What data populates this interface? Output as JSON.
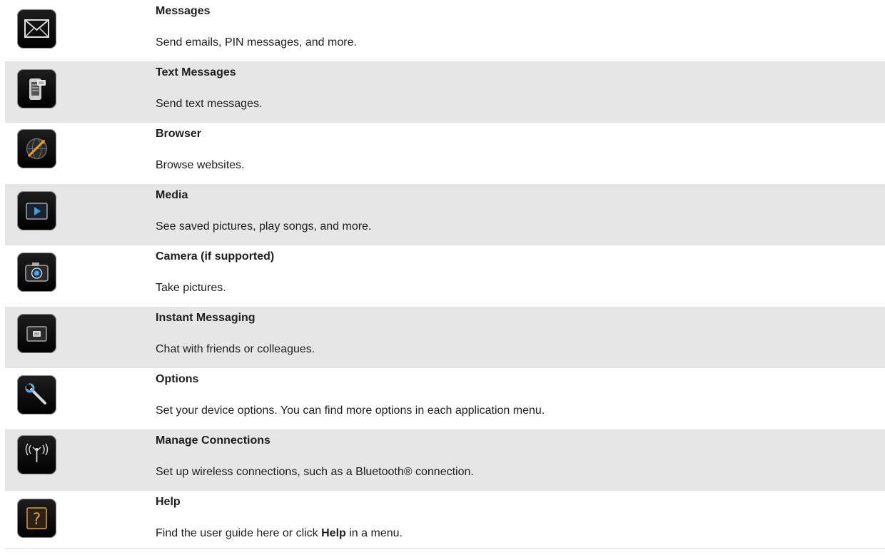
{
  "rows": [
    {
      "icon": "envelope-icon",
      "title": "Messages",
      "desc": "Send emails, PIN messages, and more."
    },
    {
      "icon": "text-message-phone-icon",
      "title": "Text Messages",
      "desc": "Send text messages."
    },
    {
      "icon": "globe-icon",
      "title": "Browser",
      "desc": "Browse websites."
    },
    {
      "icon": "media-play-icon",
      "title": "Media",
      "desc": "See saved pictures, play songs, and more."
    },
    {
      "icon": "camera-icon",
      "title": "Camera (if supported)",
      "desc": "Take pictures."
    },
    {
      "icon": "instant-messaging-icon",
      "title": "Instant Messaging",
      "desc": "Chat with friends or colleagues."
    },
    {
      "icon": "wrench-icon",
      "title": "Options",
      "desc": "Set your device options. You can find more options in each application menu."
    },
    {
      "icon": "wireless-antenna-icon",
      "title": "Manage Connections",
      "desc": "Set up wireless connections, such as a Bluetooth® connection."
    },
    {
      "icon": "question-mark-icon",
      "title": "Help",
      "desc_before": "Find the user guide here or click ",
      "desc_bold": "Help",
      "desc_after": " in a menu."
    }
  ]
}
